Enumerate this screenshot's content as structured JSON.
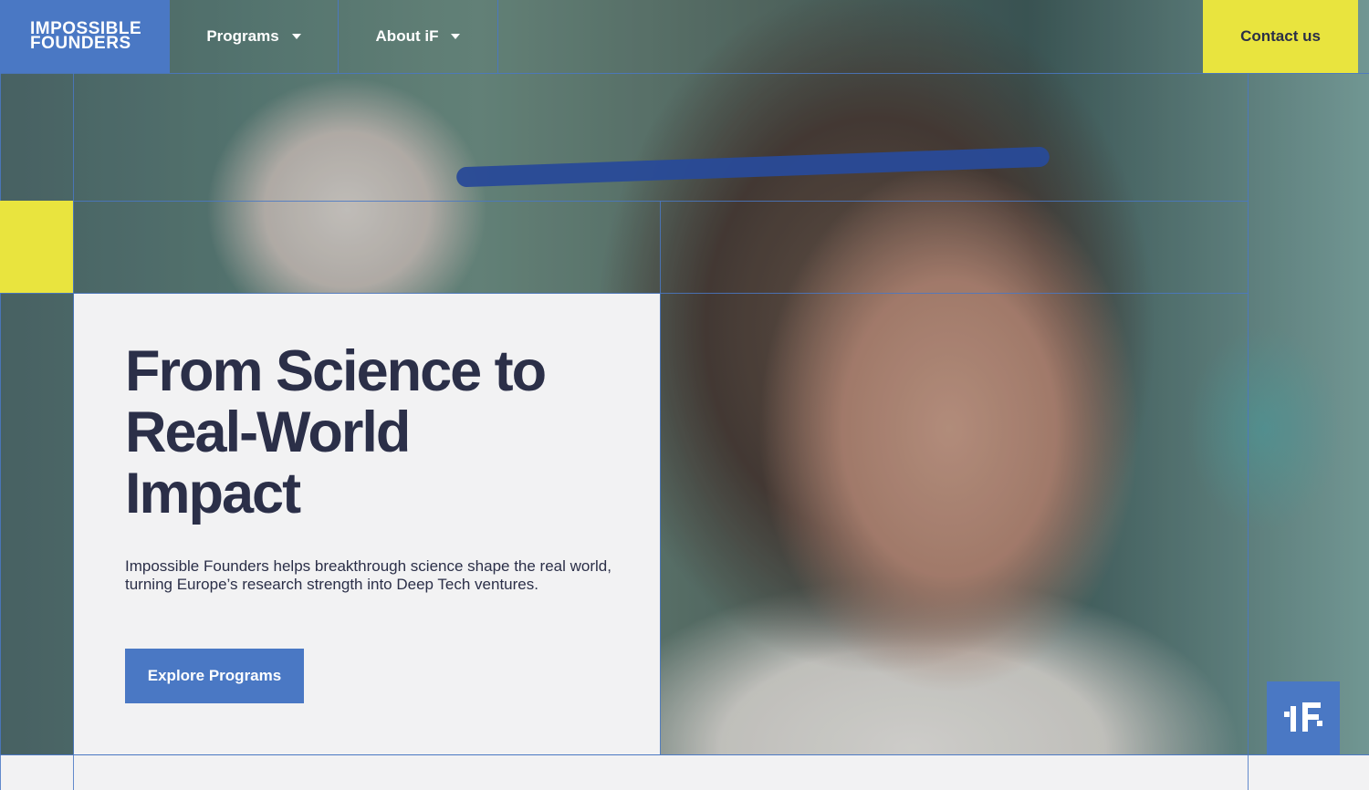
{
  "brand": {
    "logo_line1": "IMPOSSIBLE",
    "logo_line2": "FOUNDERS",
    "badge_text": "iF"
  },
  "nav": {
    "items": [
      {
        "label": "Programs"
      },
      {
        "label": "About iF"
      }
    ],
    "contact_label": "Contact us"
  },
  "hero": {
    "headline_line1": "From Science to",
    "headline_line2": "Real-World",
    "headline_line3": "Impact",
    "description": "Impossible Founders helps breakthrough science shape the real world, turning Europe’s research strength into Deep Tech ventures.",
    "cta_label": "Explore Programs"
  },
  "colors": {
    "accent_blue": "#4a78c4",
    "accent_yellow": "#e9e43e",
    "text_dark": "#2b2f48",
    "card_bg": "#f2f2f3"
  }
}
